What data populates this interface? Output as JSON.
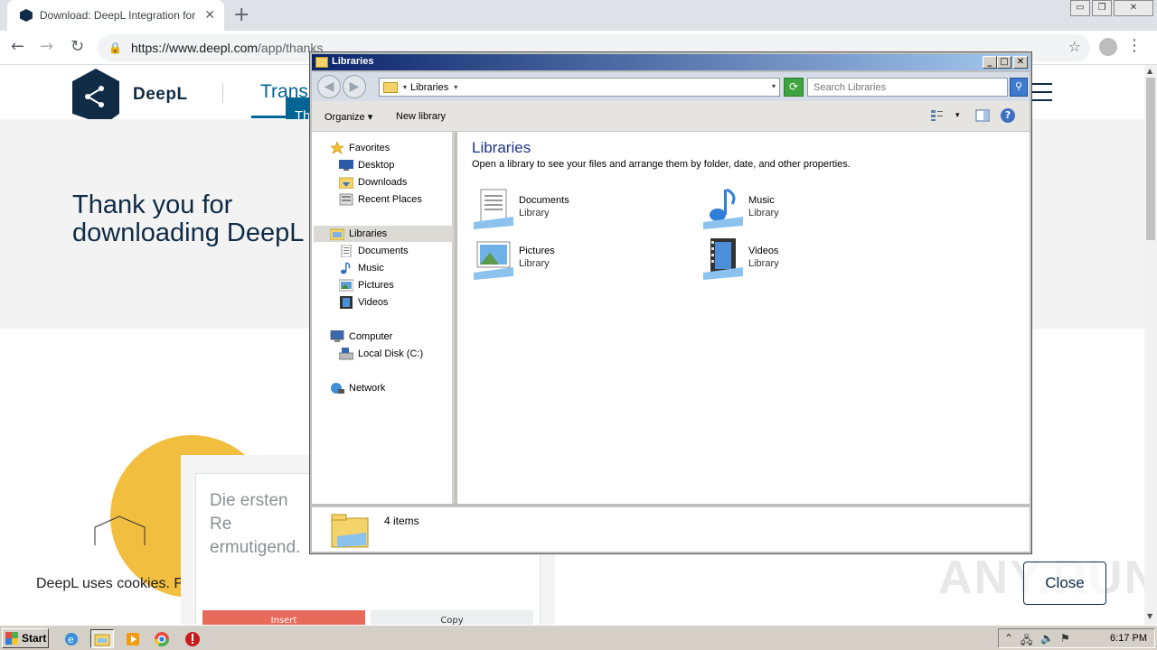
{
  "browser": {
    "tab_title": "Download: DeepL Integration for Wi",
    "tab_close": "✕",
    "new_tab": "+",
    "url_host": "https://www.deepl.com",
    "url_path": "/app/thanks",
    "back_icon": "←",
    "forward_icon": "→",
    "reload_icon": "↻",
    "lock_icon": "🔒",
    "star_icon": "☆",
    "menu_icon": "⋮",
    "win_minimize": "▭",
    "win_restore": "❐",
    "win_close": "✕"
  },
  "deepl": {
    "logo_text": "DeepL",
    "nav_translator": "Trans",
    "tooltip_text": "Th",
    "hero_title": "Thank you for downloading DeepL for Windows!",
    "demo_text": "Die ersten Re ermutigend.",
    "insert_label": "Insert",
    "copy_label": "Copy",
    "cookie_text": "DeepL uses cookies. Fo",
    "close_label": "Close",
    "watermark": "ANY.RUN",
    "brand_color": "#0f2b46",
    "accent_color": "#006494"
  },
  "explorer": {
    "title": "Libraries",
    "wbtn_min": "_",
    "wbtn_max": "□",
    "wbtn_close": "✕",
    "back_icon": "◀",
    "forward_icon": "▶",
    "path": "Libraries",
    "search_placeholder": "Search Libraries",
    "refresh_icon": "⟳",
    "search_icon": "⚲",
    "organize_label": "Organize",
    "new_library_label": "New library",
    "dropdown_icon": "▾",
    "help_icon": "?",
    "nav": {
      "favorites": "Favorites",
      "desktop": "Desktop",
      "downloads": "Downloads",
      "recent_places": "Recent Places",
      "libraries": "Libraries",
      "documents": "Documents",
      "music": "Music",
      "pictures": "Pictures",
      "videos": "Videos",
      "computer": "Computer",
      "local_disk": "Local Disk (C:)",
      "network": "Network"
    },
    "heading": "Libraries",
    "subheading": "Open a library to see your files and arrange them by folder, date, and other properties.",
    "libraries": [
      {
        "name": "Documents",
        "type": "Library"
      },
      {
        "name": "Music",
        "type": "Library"
      },
      {
        "name": "Pictures",
        "type": "Library"
      },
      {
        "name": "Videos",
        "type": "Library"
      }
    ],
    "status": "4 items"
  },
  "taskbar": {
    "start_label": "Start",
    "clock": "6:17 PM"
  }
}
